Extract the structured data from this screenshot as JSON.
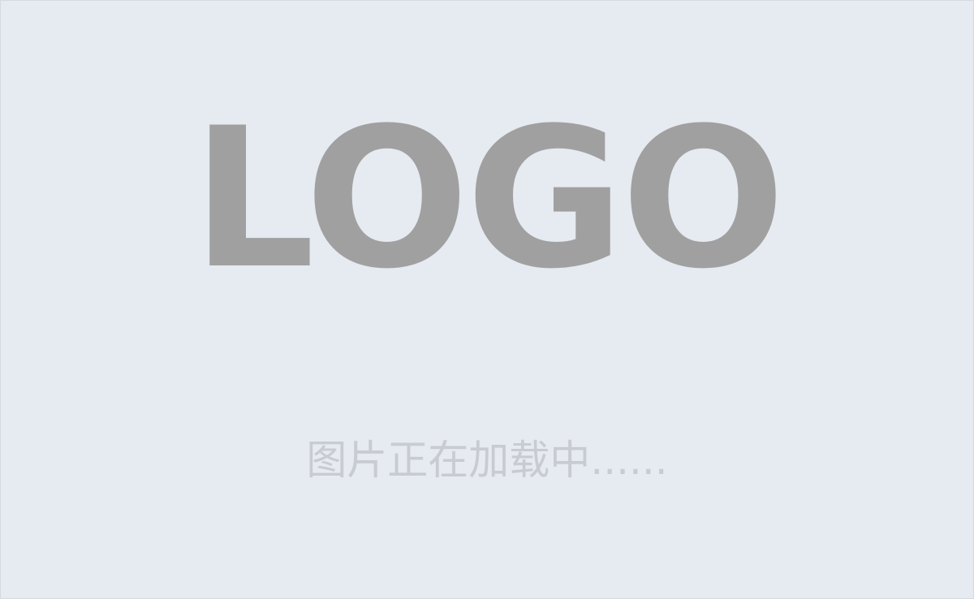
{
  "placeholder": {
    "logo_text": "LOGO",
    "loading_text": "图片正在加载中......"
  },
  "colors": {
    "background": "#e6eaf1",
    "logo": "#a0a0a0",
    "loading_text": "#c8ccd2"
  }
}
